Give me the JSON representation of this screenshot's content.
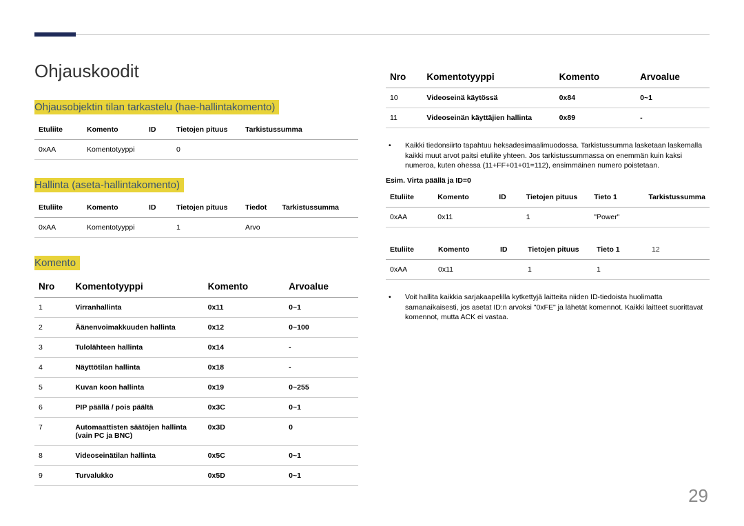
{
  "title": "Ohjauskoodit",
  "page_number": "29",
  "sections": {
    "s1": {
      "heading": "Ohjausobjektin tilan tarkastelu (hae-hallintakomento)",
      "headers": [
        "Etuliite",
        "Komento",
        "ID",
        "Tietojen pituus",
        "Tarkistussumma"
      ],
      "row": [
        "0xAA",
        "Komentotyyppi",
        "",
        "0",
        ""
      ]
    },
    "s2": {
      "heading": "Hallinta (aseta-hallintakomento)",
      "headers": [
        "Etuliite",
        "Komento",
        "ID",
        "Tietojen pituus",
        "Tiedot",
        "Tarkistussumma"
      ],
      "row": [
        "0xAA",
        "Komentotyyppi",
        "",
        "1",
        "Arvo",
        ""
      ]
    },
    "s3": {
      "heading": "Komento",
      "columns": [
        "Nro",
        "Komentotyyppi",
        "Komento",
        "Arvoalue"
      ],
      "rows_left": [
        [
          "1",
          "Virranhallinta",
          "0x11",
          "0~1"
        ],
        [
          "2",
          "Äänenvoimakkuuden hallinta",
          "0x12",
          "0~100"
        ],
        [
          "3",
          "Tulolähteen hallinta",
          "0x14",
          "-"
        ],
        [
          "4",
          "Näyttötilan hallinta",
          "0x18",
          "-"
        ],
        [
          "5",
          "Kuvan koon hallinta",
          "0x19",
          "0~255"
        ],
        [
          "6",
          "PIP päällä / pois päältä",
          "0x3C",
          "0~1"
        ],
        [
          "7",
          "Automaattisten säätöjen hallinta (vain PC ja BNC)",
          "0x3D",
          "0"
        ],
        [
          "8",
          "Videoseinätilan hallinta",
          "0x5C",
          "0~1"
        ],
        [
          "9",
          "Turvalukko",
          "0x5D",
          "0~1"
        ]
      ],
      "rows_right": [
        [
          "10",
          "Videoseinä käytössä",
          "0x84",
          "0~1"
        ],
        [
          "11",
          "Videoseinän käyttäjien hallinta",
          "0x89",
          "-"
        ]
      ]
    },
    "note1": "Kaikki tiedonsiirto tapahtuu heksadesimaalimuodossa. Tarkistussumma lasketaan laskemalla kaikki muut arvot paitsi etuliite yhteen. Jos tarkistussummassa on enemmän kuin kaksi numeroa, kuten ohessa (11+FF+01+01=112), ensimmäinen numero poistetaan.",
    "example_label": "Esim. Virta päällä ja ID=0",
    "ex1": {
      "headers": [
        "Etuliite",
        "Komento",
        "ID",
        "Tietojen pituus",
        "Tieto 1",
        "Tarkistussumma"
      ],
      "row": [
        "0xAA",
        "0x11",
        "",
        "1",
        "\"Power\"",
        ""
      ]
    },
    "ex2": {
      "headers": [
        "Etuliite",
        "Komento",
        "ID",
        "Tietojen pituus",
        "Tieto 1",
        "12"
      ],
      "row": [
        "0xAA",
        "0x11",
        "",
        "1",
        "1",
        ""
      ]
    },
    "note2": "Voit hallita kaikkia sarjakaapelilla kytkettyjä laitteita niiden ID-tiedoista huolimatta samanaikaisesti, jos asetat ID:n arvoksi \"0xFE\" ja lähetät komennot. Kaikki laitteet suorittavat komennot, mutta ACK ei vastaa."
  }
}
